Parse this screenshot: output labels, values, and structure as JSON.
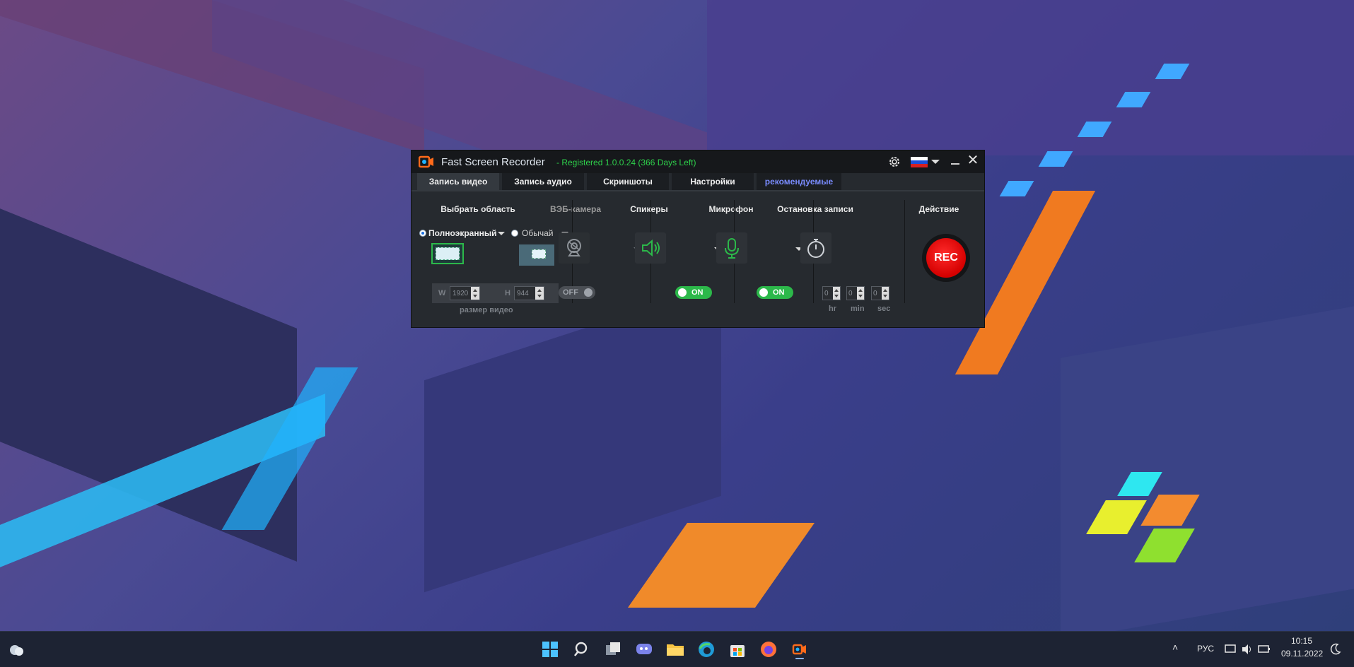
{
  "app": {
    "title": "Fast Screen Recorder",
    "registration": "- Registered 1.0.0.24 (366 Days Left)",
    "icons": {
      "settings": "gear-icon",
      "language": "flag-russia-icon",
      "minimize": "minimize-icon",
      "close": "close-icon"
    },
    "close_glyph": "✕"
  },
  "tabs": [
    {
      "label": "Запись видео",
      "active": true
    },
    {
      "label": "Запись аудио",
      "active": false
    },
    {
      "label": "Скриншоты",
      "active": false
    },
    {
      "label": "Настройки",
      "active": false
    },
    {
      "label": "рекомендуемые",
      "active": false
    }
  ],
  "area": {
    "header": "Выбрать область",
    "fullscreen_label": "Полноэкранный",
    "normal_label": "Обычай",
    "selected": "fullscreen",
    "width_label": "W",
    "width_value": "1920",
    "height_label": "H",
    "height_value": "944",
    "caption": "размер видео"
  },
  "webcam": {
    "header": "ВЭБ-камера",
    "toggle": "OFF",
    "enabled": false
  },
  "speakers": {
    "header": "Спикеры",
    "toggle": "ON",
    "enabled": true
  },
  "microphone": {
    "header": "Микрофон",
    "toggle": "ON",
    "enabled": true
  },
  "stop": {
    "header": "Остановка записи",
    "hr": "0",
    "min": "0",
    "sec": "0",
    "hr_label": "hr",
    "min_label": "min",
    "sec_label": "sec"
  },
  "action": {
    "header": "Действие",
    "rec_label": "REC",
    "color": "#e00000"
  },
  "taskbar": {
    "lang": "РУС",
    "time": "10:15",
    "date": "09.11.2022",
    "pinned": [
      "start-icon",
      "search-icon",
      "task-view-icon",
      "chat-icon",
      "file-explorer-icon",
      "edge-icon",
      "store-icon",
      "firefox-icon",
      "fast-screen-recorder-icon"
    ]
  },
  "colors": {
    "accent_green": "#2cb84a",
    "registered_text": "#2ed14b",
    "rec_red": "#e00000",
    "link_blue": "#7a8cff"
  }
}
